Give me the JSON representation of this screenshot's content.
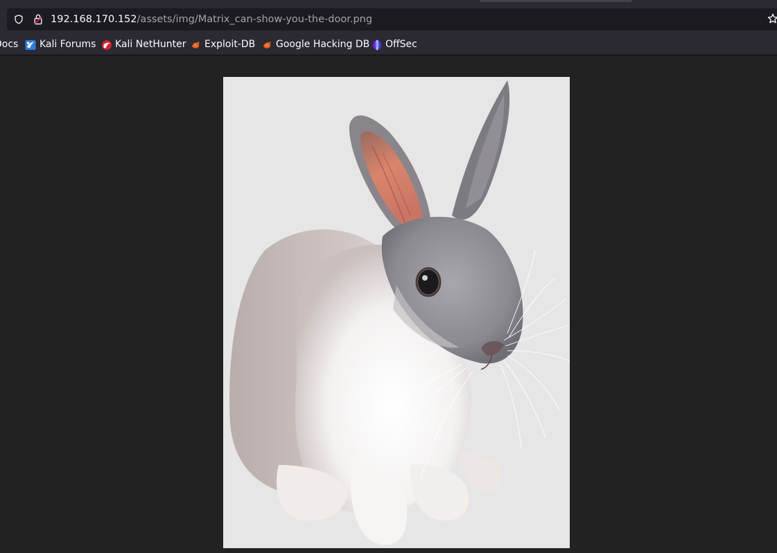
{
  "browser": {
    "url": {
      "host": "192.168.170.152",
      "path": "/assets/img/Matrix_can-show-you-the-door.png"
    },
    "icons": {
      "shield": "shield-icon",
      "lock": "lock-warning-icon",
      "bookmark_star": "star-icon"
    },
    "bookmarks": [
      {
        "label": "Docs",
        "icon": "none"
      },
      {
        "label": "Kali Forums",
        "icon": "kali-forums-icon"
      },
      {
        "label": "Kali NetHunter",
        "icon": "kali-nethunter-icon"
      },
      {
        "label": "Exploit-DB",
        "icon": "exploit-db-icon"
      },
      {
        "label": "Google Hacking DB",
        "icon": "exploit-db-icon"
      },
      {
        "label": "OffSec",
        "icon": "offsec-icon"
      }
    ]
  },
  "page": {
    "image": {
      "subject": "white-and-grey rabbit photo",
      "background_color": "#e6e6e6"
    }
  },
  "colors": {
    "toolbar": "#2b2a33",
    "urlbar": "#1c1b22",
    "viewport_background": "#222222",
    "text": "#fbfbfe",
    "url_path_text": "#a4a3ab"
  }
}
